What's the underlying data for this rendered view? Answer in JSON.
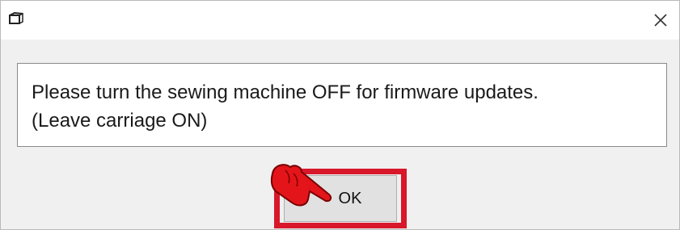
{
  "dialog": {
    "title_icon": "app-window-icon",
    "close_icon": "close-icon",
    "message_lines": [
      "Please turn the sewing machine OFF for firmware updates.",
      "(Leave carriage ON)"
    ],
    "ok_label": "OK"
  },
  "annotation": {
    "highlight_color": "#d8172a",
    "pointer_icon": "pointing-hand-icon"
  }
}
